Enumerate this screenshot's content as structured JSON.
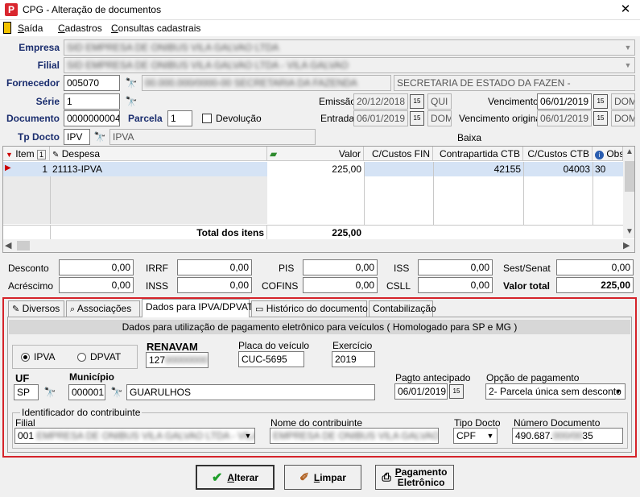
{
  "window": {
    "title": "CPG - Alteração de documentos",
    "close": "✕"
  },
  "menu": [
    "Saída",
    "Cadastros",
    "Consultas cadastrais"
  ],
  "header": {
    "empresa_label": "Empresa",
    "empresa_value": "SID EMPRESA DE ONIBUS VILA GALVAO LTDA",
    "filial_label": "Filial",
    "filial_value": "SID EMPRESA DE ONIBUS VILA GALVAO LTDA - VILA GALVAO",
    "fornecedor_label": "Fornecedor",
    "fornecedor_code": "005070",
    "fornecedor_doc": "00.000.000/0000-00 SECRETARIA DA FAZENDA",
    "fornecedor_name": "SECRETARIA DE ESTADO DA FAZEN -",
    "serie_label": "Série",
    "serie_value": "1",
    "documento_label": "Documento",
    "documento_value": "0000000004",
    "parcela_label": "Parcela",
    "parcela_value": "1",
    "devolucao_label": "Devolução",
    "tpdocto_label": "Tp Docto",
    "tpdocto_code": "IPV",
    "tpdocto_desc": "IPVA",
    "emissao_label": "Emissão",
    "emissao_date": "20/12/2018",
    "emissao_day": "QUI",
    "entrada_label": "Entrada",
    "entrada_date": "06/01/2019",
    "entrada_day": "DOM",
    "vencimento_label": "Vencimento",
    "vencimento_date": "06/01/2019",
    "vencimento_day": "DOM",
    "venc_original_label": "Vencimento original",
    "venc_original_date": "06/01/2019",
    "venc_original_day": "DOM",
    "baixa_label": "Baixa",
    "cal_icon": "15"
  },
  "grid": {
    "columns": [
      "Item",
      "1",
      "Despesa",
      "Valor",
      "C/Custos FIN",
      "Contrapartida CTB",
      "C/Custos CTB",
      "Obs"
    ],
    "row": {
      "item": "1",
      "despesa": "21113-IPVA",
      "valor": "225,00",
      "contrapartida": "42155",
      "custos_ctb": "04003",
      "obs": "30"
    },
    "total_label": "Total dos itens",
    "total_value": "225,00"
  },
  "totals": {
    "desconto_label": "Desconto",
    "desconto": "0,00",
    "irrf_label": "IRRF",
    "irrf": "0,00",
    "pis_label": "PIS",
    "pis": "0,00",
    "iss_label": "ISS",
    "iss": "0,00",
    "sestsenat_label": "Sest/Senat",
    "sestsenat": "0,00",
    "acrescimo_label": "Acréscimo",
    "acrescimo": "0,00",
    "inss_label": "INSS",
    "inss": "0,00",
    "cofins_label": "COFINS",
    "cofins": "0,00",
    "csll_label": "CSLL",
    "csll": "0,00",
    "valortotal_label": "Valor total",
    "valortotal": "225,00"
  },
  "tabs": [
    "Diversos",
    "Associações",
    "Dados para IPVA/DPVAT",
    "Histórico do documento",
    "Contabilização"
  ],
  "ipva": {
    "section_title": "Dados para utilização de pagamento eletrônico para veículos ( Homologado para  SP e MG )",
    "radio_ipva": "IPVA",
    "radio_dpvat": "DPVAT",
    "renavam_label": "RENAVAM",
    "renavam_prefix": "127",
    "renavam_hidden": "00000000",
    "placa_label": "Placa do veículo",
    "placa_value": "CUC-5695",
    "exercicio_label": "Exercício",
    "exercicio_value": "2019",
    "uf_label": "UF",
    "uf_value": "SP",
    "municipio_label": "Município",
    "municipio_code": "000001",
    "municipio_name": "GUARULHOS",
    "pagto_label": "Pagto antecipado",
    "pagto_date": "06/01/2019",
    "opcao_label": "Opção de pagamento",
    "opcao_value": "2- Parcela única sem desconto",
    "contrib_group": "Identificador do contribuinte",
    "filial_label": "Filial",
    "filial_prefix": "001",
    "filial_hidden": "EMPRESA DE ONIBUS VILA GALVAO LTDA - VILA",
    "nome_label": "Nome do contribuinte",
    "nome_hidden": "EMPRESA DE ONIBUS VILA GALVAO LTDA",
    "tipo_label": "Tipo Docto",
    "tipo_value": "CPF",
    "numdoc_label": "Número Documento",
    "numdoc_prefix": "490.687.",
    "numdoc_hidden": "000/00",
    "numdoc_suffix": "35"
  },
  "buttons": {
    "alterar": "Alterar",
    "limpar": "Limpar",
    "pagamento_1": "Pagamento",
    "pagamento_2": "Eletrônico"
  }
}
